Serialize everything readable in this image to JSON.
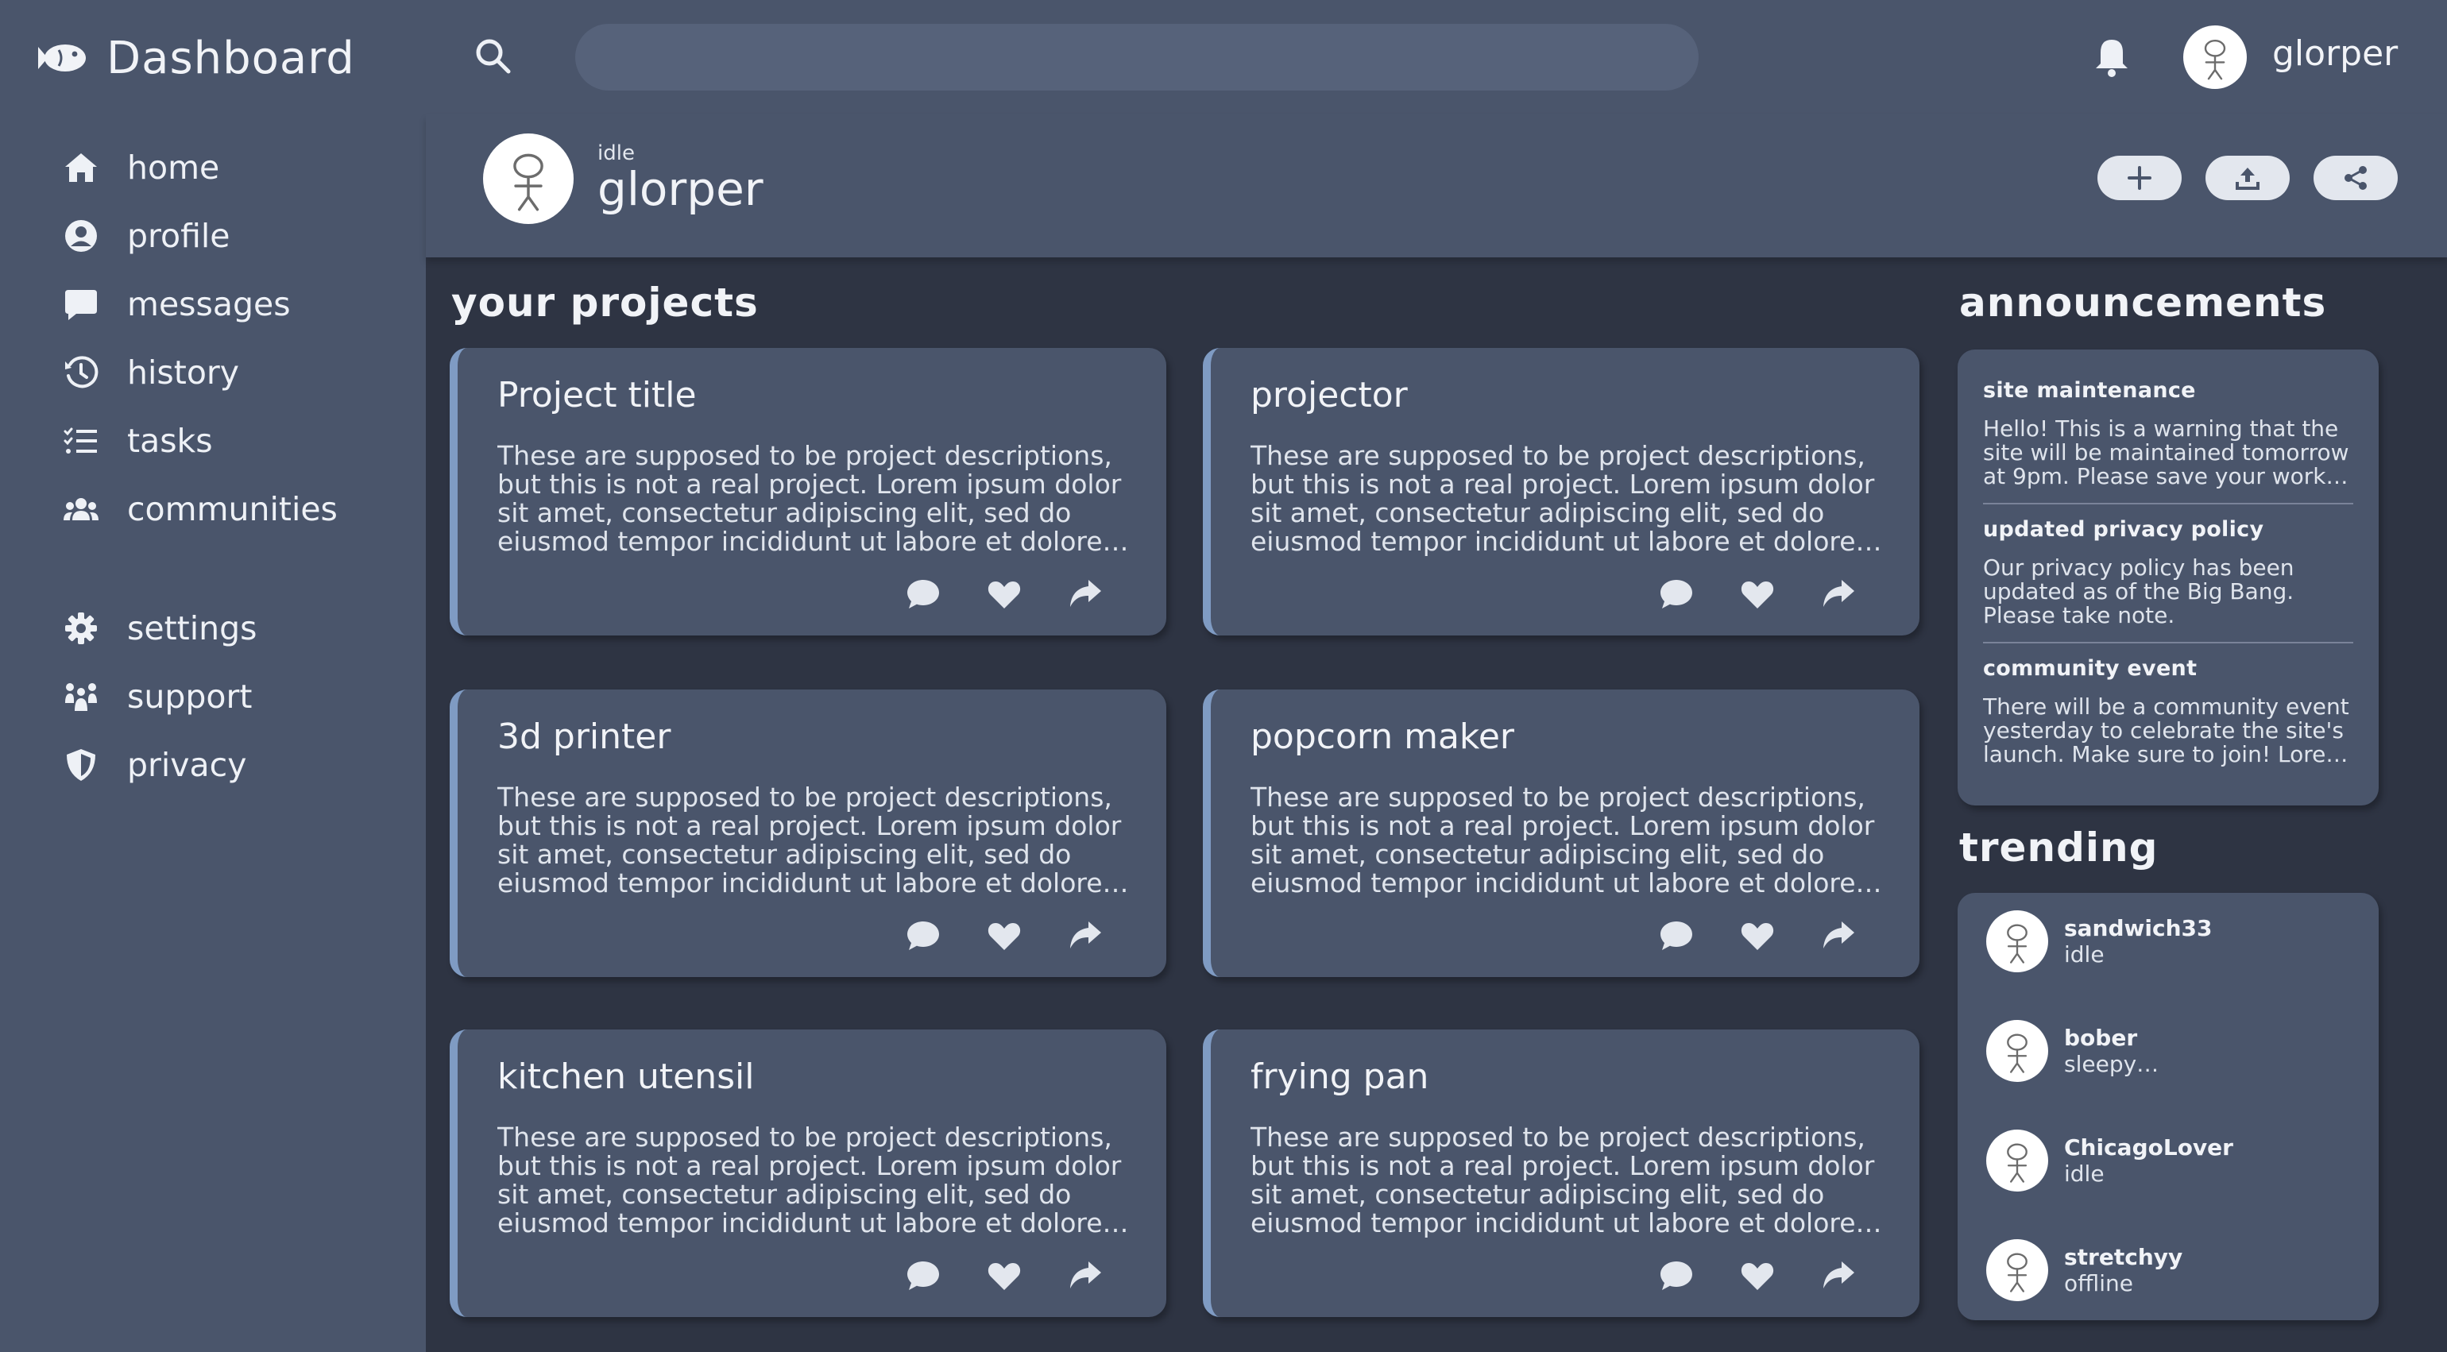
{
  "brand": {
    "title": "Dashboard",
    "icon": "fish-icon"
  },
  "nav": {
    "items": [
      {
        "label": "home",
        "icon": "home-icon"
      },
      {
        "label": "profile",
        "icon": "user-circle-icon"
      },
      {
        "label": "messages",
        "icon": "message-icon"
      },
      {
        "label": "history",
        "icon": "history-icon"
      },
      {
        "label": "tasks",
        "icon": "tasks-icon"
      },
      {
        "label": "communities",
        "icon": "users-icon"
      }
    ],
    "secondary": [
      {
        "label": "settings",
        "icon": "gear-icon"
      },
      {
        "label": "support",
        "icon": "support-icon"
      },
      {
        "label": "privacy",
        "icon": "shield-icon"
      }
    ]
  },
  "topbar": {
    "search_placeholder": "",
    "username": "glorper"
  },
  "profile": {
    "status": "idle",
    "name": "glorper",
    "actions": [
      "plus-icon",
      "upload-icon",
      "share-icon"
    ]
  },
  "projects": {
    "heading": "your projects",
    "items": [
      {
        "title": "Project title",
        "description": "These are supposed to be project descriptions, but this is not a real project. Lorem ipsum dolor sit amet, consectetur adipiscing elit, sed do eiusmod tempor incididunt ut labore et dolore…"
      },
      {
        "title": "projector",
        "description": "These are supposed to be project descriptions, but this is not a real project. Lorem ipsum dolor sit amet, consectetur adipiscing elit, sed do eiusmod tempor incididunt ut labore et dolore…"
      },
      {
        "title": "3d printer",
        "description": "These are supposed to be project descriptions, but this is not a real project. Lorem ipsum dolor sit amet, consectetur adipiscing elit, sed do eiusmod tempor incididunt ut labore et dolore…"
      },
      {
        "title": "popcorn maker",
        "description": "These are supposed to be project descriptions, but this is not a real project. Lorem ipsum dolor sit amet, consectetur adipiscing elit, sed do eiusmod tempor incididunt ut labore et dolore…"
      },
      {
        "title": "kitchen utensil",
        "description": "These are supposed to be project descriptions, but this is not a real project. Lorem ipsum dolor sit amet, consectetur adipiscing elit, sed do eiusmod tempor incididunt ut labore et dolore…"
      },
      {
        "title": "frying pan",
        "description": "These are supposed to be project descriptions, but this is not a real project. Lorem ipsum dolor sit amet, consectetur adipiscing elit, sed do eiusmod tempor incididunt ut labore et dolore…"
      }
    ]
  },
  "announcements": {
    "heading": "announcements",
    "items": [
      {
        "title": "site maintenance",
        "body": "Hello! This is a warning that the site will be maintained tomorrow at 9pm. Please save your work…"
      },
      {
        "title": "updated privacy policy",
        "body": "Our privacy policy has been updated as of the Big Bang. Please take note."
      },
      {
        "title": "community event",
        "body": "There will be a community event yesterday to celebrate the site's launch. Make sure to join! Lore…"
      }
    ]
  },
  "trending": {
    "heading": "trending",
    "users": [
      {
        "name": "sandwich33",
        "status": "idle"
      },
      {
        "name": "bober",
        "status": "sleepy…"
      },
      {
        "name": "ChicagoLover",
        "status": "idle"
      },
      {
        "name": "stretchyy",
        "status": "offline"
      }
    ]
  },
  "colors": {
    "background": "#2e3443",
    "surface": "#4a556b",
    "accent": "#7f9bc3",
    "text": "#f1f3f7"
  }
}
